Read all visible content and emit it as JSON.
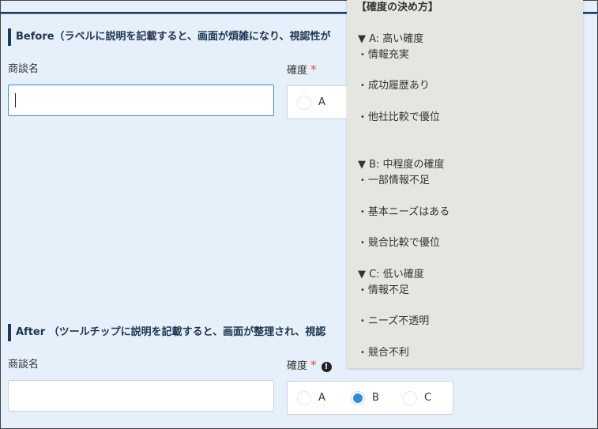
{
  "before": {
    "heading": "Before（ラベルに説明を記載すると、画面が煩雑になり、視認性が",
    "deal_name_label": "商談名",
    "deal_name_value": "",
    "certainty_label": "確度",
    "required_mark": "*",
    "options": [
      "A"
    ]
  },
  "after": {
    "heading": "After （ツールチップに説明を記載すると、画面が整理され、視認",
    "deal_name_label": "商談名",
    "deal_name_value": "",
    "certainty_label": "確度",
    "required_mark": "*",
    "info_icon_glyph": "!",
    "options": [
      "A",
      "B",
      "C"
    ],
    "selected": "B"
  },
  "tooltip": {
    "title": "【確度の決め方】",
    "grades": [
      {
        "label": "▼ A: 高い確度",
        "items": [
          "情報充実",
          "成功履歴あり",
          "他社比較で優位"
        ]
      },
      {
        "label": "▼ B: 中程度の確度",
        "items": [
          "一部情報不足",
          "基本ニーズはある",
          "競合比較で優位"
        ]
      },
      {
        "label": "▼ C: 低い確度",
        "items": [
          "情報不足",
          "ニーズ不透明",
          "競合不利"
        ]
      }
    ],
    "bullet": "•"
  },
  "colors": {
    "page_bg": "#e6f0fa",
    "heading_bar": "#1b3a5f",
    "required": "#e0453a",
    "focus_border": "#3c8fcf",
    "radio_selected": "#2c8fd6",
    "tooltip_bg": "#e6e6e1"
  }
}
